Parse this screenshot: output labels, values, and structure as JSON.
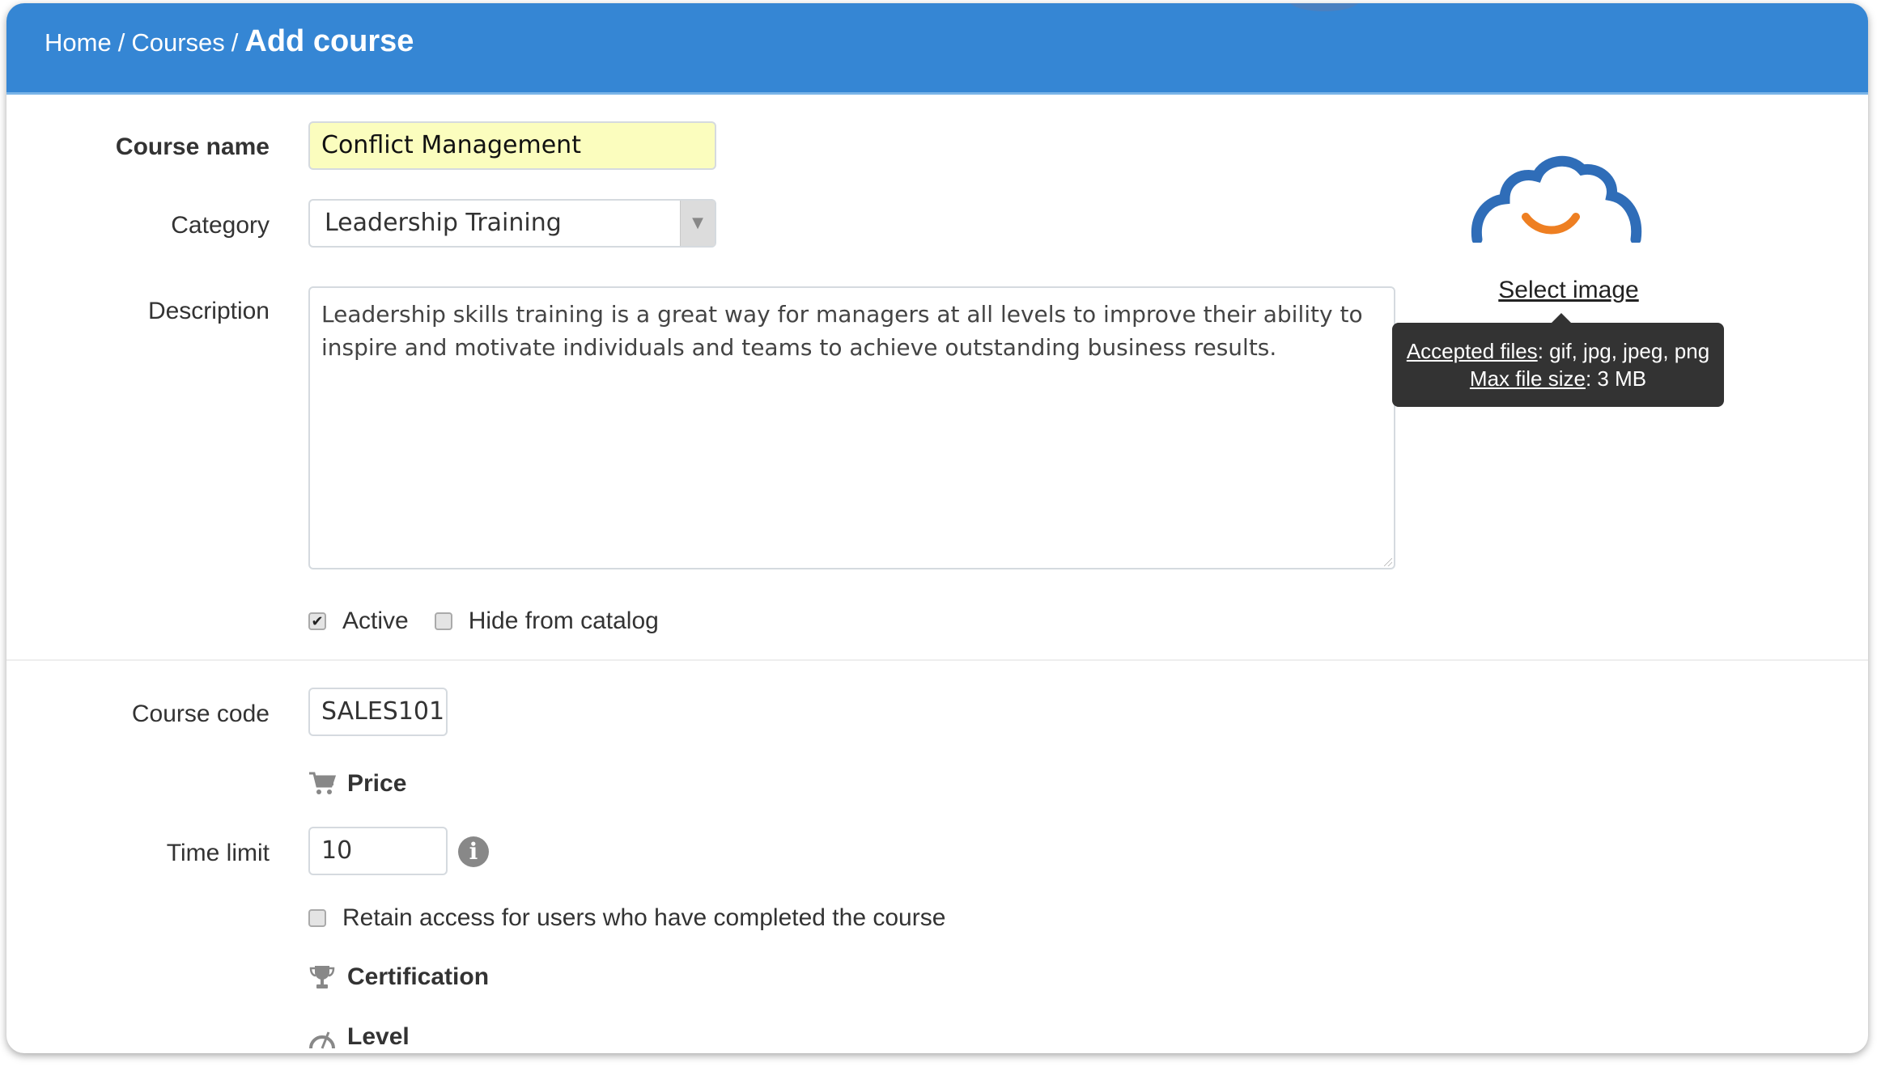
{
  "header": {
    "breadcrumb": [
      {
        "label": "Home"
      },
      {
        "label": "Courses"
      }
    ],
    "separator": "/",
    "current": "Add course",
    "color": "#3586d4"
  },
  "form": {
    "course_name": {
      "label": "Course name",
      "value": "Conflict Management"
    },
    "category": {
      "label": "Category",
      "value": "Leadership Training"
    },
    "description": {
      "label": "Description",
      "value": "Leadership skills training is a great way for managers at all levels to improve their ability to inspire and motivate individuals and teams to achieve outstanding business results."
    },
    "active": {
      "label": "Active",
      "checked": true
    },
    "hide_from_catalog": {
      "label": "Hide from catalog",
      "checked": false
    },
    "course_code": {
      "label": "Course code",
      "value": "SALES101"
    },
    "price": {
      "label": "Price",
      "icon": "shopping-cart-icon"
    },
    "time_limit": {
      "label": "Time limit",
      "value": "10",
      "info_icon": "info-icon"
    },
    "retain_access": {
      "label": "Retain access for users who have completed the course",
      "checked": false
    },
    "certification": {
      "label": "Certification",
      "icon": "trophy-icon"
    },
    "level": {
      "label": "Level",
      "icon": "gauge-icon"
    }
  },
  "image_upload": {
    "icon": "cloud-smile-icon",
    "select_label": "Select image",
    "tooltip": {
      "accepted_label": "Accepted files",
      "accepted_value": ": gif, jpg, jpeg, png",
      "max_label": "Max file size",
      "max_value": ": 3 MB"
    },
    "colors": {
      "cloud": "#2f6db8",
      "smile": "#ee7f22"
    }
  }
}
